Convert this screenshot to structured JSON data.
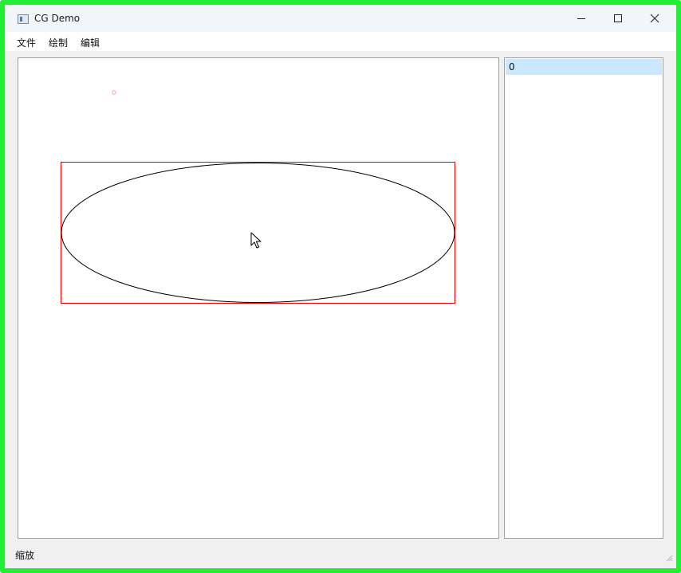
{
  "window": {
    "title": "CG Demo"
  },
  "menu": {
    "items": [
      "文件",
      "绘制",
      "编辑"
    ]
  },
  "item_list": {
    "items": [
      "0"
    ]
  },
  "status": {
    "text": "缩放"
  },
  "colors": {
    "frame_highlight": "#22ee33",
    "bounding_box": "#e00000",
    "ellipse": "#000000",
    "selected_row": "#cce8ff"
  },
  "icons": {
    "app": "app-window-icon",
    "minimize": "minimize-icon",
    "maximize": "maximize-icon",
    "close": "close-icon",
    "cursor": "mouse-pointer-icon",
    "grip": "size-grip-icon"
  }
}
